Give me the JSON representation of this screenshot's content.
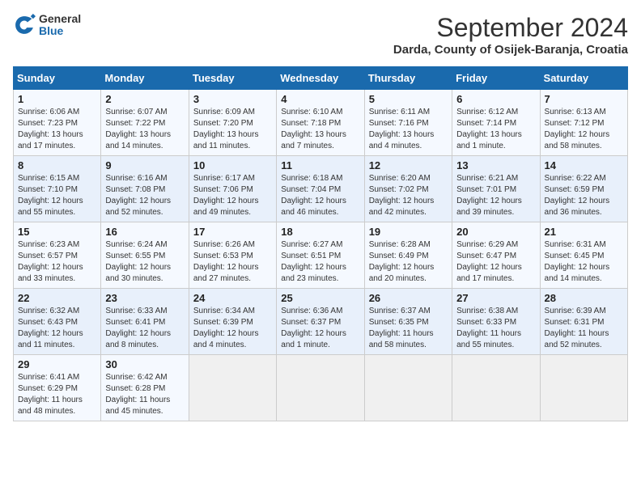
{
  "header": {
    "logo_general": "General",
    "logo_blue": "Blue",
    "month_title": "September 2024",
    "location": "Darda, County of Osijek-Baranja, Croatia"
  },
  "weekdays": [
    "Sunday",
    "Monday",
    "Tuesday",
    "Wednesday",
    "Thursday",
    "Friday",
    "Saturday"
  ],
  "weeks": [
    [
      {
        "day": "1",
        "info": "Sunrise: 6:06 AM\nSunset: 7:23 PM\nDaylight: 13 hours and 17 minutes."
      },
      {
        "day": "2",
        "info": "Sunrise: 6:07 AM\nSunset: 7:22 PM\nDaylight: 13 hours and 14 minutes."
      },
      {
        "day": "3",
        "info": "Sunrise: 6:09 AM\nSunset: 7:20 PM\nDaylight: 13 hours and 11 minutes."
      },
      {
        "day": "4",
        "info": "Sunrise: 6:10 AM\nSunset: 7:18 PM\nDaylight: 13 hours and 7 minutes."
      },
      {
        "day": "5",
        "info": "Sunrise: 6:11 AM\nSunset: 7:16 PM\nDaylight: 13 hours and 4 minutes."
      },
      {
        "day": "6",
        "info": "Sunrise: 6:12 AM\nSunset: 7:14 PM\nDaylight: 13 hours and 1 minute."
      },
      {
        "day": "7",
        "info": "Sunrise: 6:13 AM\nSunset: 7:12 PM\nDaylight: 12 hours and 58 minutes."
      }
    ],
    [
      {
        "day": "8",
        "info": "Sunrise: 6:15 AM\nSunset: 7:10 PM\nDaylight: 12 hours and 55 minutes."
      },
      {
        "day": "9",
        "info": "Sunrise: 6:16 AM\nSunset: 7:08 PM\nDaylight: 12 hours and 52 minutes."
      },
      {
        "day": "10",
        "info": "Sunrise: 6:17 AM\nSunset: 7:06 PM\nDaylight: 12 hours and 49 minutes."
      },
      {
        "day": "11",
        "info": "Sunrise: 6:18 AM\nSunset: 7:04 PM\nDaylight: 12 hours and 46 minutes."
      },
      {
        "day": "12",
        "info": "Sunrise: 6:20 AM\nSunset: 7:02 PM\nDaylight: 12 hours and 42 minutes."
      },
      {
        "day": "13",
        "info": "Sunrise: 6:21 AM\nSunset: 7:01 PM\nDaylight: 12 hours and 39 minutes."
      },
      {
        "day": "14",
        "info": "Sunrise: 6:22 AM\nSunset: 6:59 PM\nDaylight: 12 hours and 36 minutes."
      }
    ],
    [
      {
        "day": "15",
        "info": "Sunrise: 6:23 AM\nSunset: 6:57 PM\nDaylight: 12 hours and 33 minutes."
      },
      {
        "day": "16",
        "info": "Sunrise: 6:24 AM\nSunset: 6:55 PM\nDaylight: 12 hours and 30 minutes."
      },
      {
        "day": "17",
        "info": "Sunrise: 6:26 AM\nSunset: 6:53 PM\nDaylight: 12 hours and 27 minutes."
      },
      {
        "day": "18",
        "info": "Sunrise: 6:27 AM\nSunset: 6:51 PM\nDaylight: 12 hours and 23 minutes."
      },
      {
        "day": "19",
        "info": "Sunrise: 6:28 AM\nSunset: 6:49 PM\nDaylight: 12 hours and 20 minutes."
      },
      {
        "day": "20",
        "info": "Sunrise: 6:29 AM\nSunset: 6:47 PM\nDaylight: 12 hours and 17 minutes."
      },
      {
        "day": "21",
        "info": "Sunrise: 6:31 AM\nSunset: 6:45 PM\nDaylight: 12 hours and 14 minutes."
      }
    ],
    [
      {
        "day": "22",
        "info": "Sunrise: 6:32 AM\nSunset: 6:43 PM\nDaylight: 12 hours and 11 minutes."
      },
      {
        "day": "23",
        "info": "Sunrise: 6:33 AM\nSunset: 6:41 PM\nDaylight: 12 hours and 8 minutes."
      },
      {
        "day": "24",
        "info": "Sunrise: 6:34 AM\nSunset: 6:39 PM\nDaylight: 12 hours and 4 minutes."
      },
      {
        "day": "25",
        "info": "Sunrise: 6:36 AM\nSunset: 6:37 PM\nDaylight: 12 hours and 1 minute."
      },
      {
        "day": "26",
        "info": "Sunrise: 6:37 AM\nSunset: 6:35 PM\nDaylight: 11 hours and 58 minutes."
      },
      {
        "day": "27",
        "info": "Sunrise: 6:38 AM\nSunset: 6:33 PM\nDaylight: 11 hours and 55 minutes."
      },
      {
        "day": "28",
        "info": "Sunrise: 6:39 AM\nSunset: 6:31 PM\nDaylight: 11 hours and 52 minutes."
      }
    ],
    [
      {
        "day": "29",
        "info": "Sunrise: 6:41 AM\nSunset: 6:29 PM\nDaylight: 11 hours and 48 minutes."
      },
      {
        "day": "30",
        "info": "Sunrise: 6:42 AM\nSunset: 6:28 PM\nDaylight: 11 hours and 45 minutes."
      },
      {
        "day": "",
        "info": ""
      },
      {
        "day": "",
        "info": ""
      },
      {
        "day": "",
        "info": ""
      },
      {
        "day": "",
        "info": ""
      },
      {
        "day": "",
        "info": ""
      }
    ]
  ]
}
